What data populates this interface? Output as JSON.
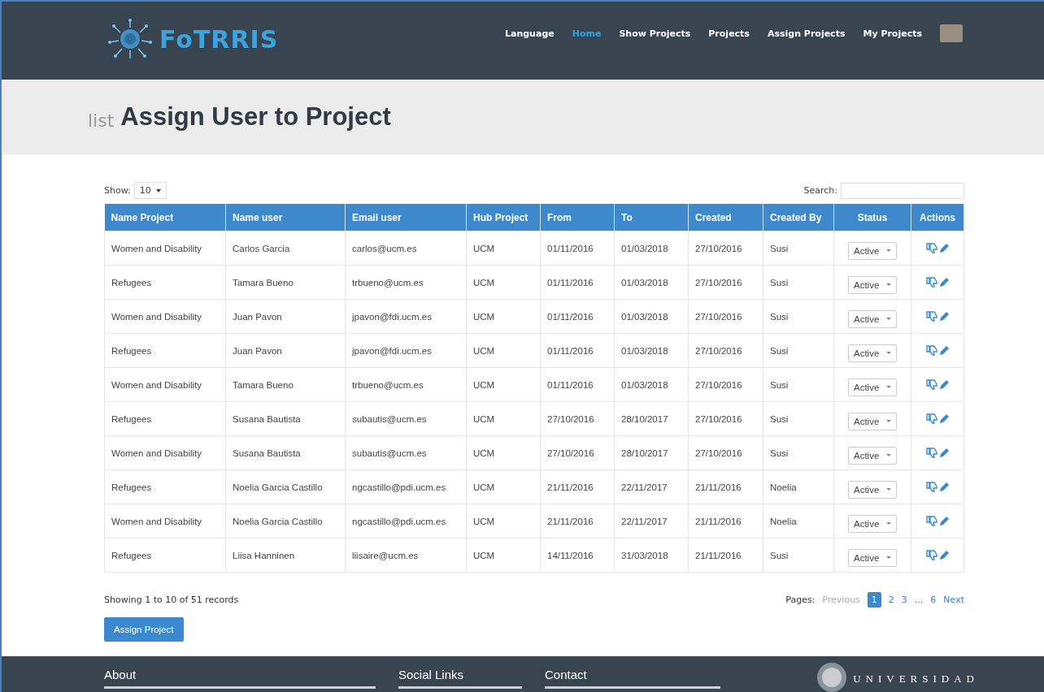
{
  "header": {
    "logo": "FoTRRIS",
    "nav": [
      {
        "label": "Language",
        "selected": false
      },
      {
        "label": "Home",
        "selected": true
      },
      {
        "label": "Show Projects",
        "selected": false
      },
      {
        "label": "Projects",
        "selected": false
      },
      {
        "label": "Assign Projects",
        "selected": false
      },
      {
        "label": "My Projects",
        "selected": false
      }
    ]
  },
  "page_title": {
    "prefix": "list",
    "title": "Assign User to Project"
  },
  "table_controls": {
    "show_label": "Show:",
    "show_value": "10",
    "search_label": "Search:"
  },
  "table": {
    "columns": [
      "Name Project",
      "Name user",
      "Email user",
      "Hub Project",
      "From",
      "To",
      "Created",
      "Created By",
      "Status",
      "Actions"
    ],
    "rows": [
      [
        "Women and Disability",
        "Carlos Garcia",
        "carlos@ucm.es",
        "UCM",
        "01/11/2016",
        "01/03/2018",
        "27/10/2016",
        "Susi",
        "Active"
      ],
      [
        "Refugees",
        "Tamara Bueno",
        "trbueno@ucm.es",
        "UCM",
        "01/11/2016",
        "01/03/2018",
        "27/10/2016",
        "Susi",
        "Active"
      ],
      [
        "Women and Disability",
        "Juan Pavon",
        "jpavon@fdi.ucm.es",
        "UCM",
        "01/11/2016",
        "01/03/2018",
        "27/10/2016",
        "Susi",
        "Active"
      ],
      [
        "Refugees",
        "Juan Pavon",
        "jpavon@fdi.ucm.es",
        "UCM",
        "01/11/2016",
        "01/03/2018",
        "27/10/2016",
        "Susi",
        "Active"
      ],
      [
        "Women and Disability",
        "Tamara Bueno",
        "trbueno@ucm.es",
        "UCM",
        "01/11/2016",
        "01/03/2018",
        "27/10/2016",
        "Susi",
        "Active"
      ],
      [
        "Refugees",
        "Susana Bautista",
        "subautis@ucm.es",
        "UCM",
        "27/10/2016",
        "28/10/2017",
        "27/10/2016",
        "Susi",
        "Active"
      ],
      [
        "Women and Disability",
        "Susana Bautista",
        "subautis@ucm.es",
        "UCM",
        "27/10/2016",
        "28/10/2017",
        "27/10/2016",
        "Susi",
        "Active"
      ],
      [
        "Refugees",
        "Noelia Garcia Castillo",
        "ngcastillo@pdi.ucm.es",
        "UCM",
        "21/11/2016",
        "22/11/2017",
        "21/11/2016",
        "Noelia",
        "Active"
      ],
      [
        "Women and Disability",
        "Noelia Garcia Castillo",
        "ngcastillo@pdi.ucm.es",
        "UCM",
        "21/11/2016",
        "22/11/2017",
        "21/11/2016",
        "Noelia",
        "Active"
      ],
      [
        "Refugees",
        "Liisa Hanninen",
        "liisaire@ucm.es",
        "UCM",
        "14/11/2016",
        "31/03/2018",
        "21/11/2016",
        "Susi",
        "Active"
      ]
    ]
  },
  "info": "Showing 1 to 10 of 51 records",
  "pagination": {
    "label": "Pages:",
    "items": [
      {
        "label": "Previous",
        "kind": "link",
        "disabled": true,
        "selected": false
      },
      {
        "label": "1",
        "kind": "page",
        "disabled": false,
        "selected": true
      },
      {
        "label": "2",
        "kind": "page",
        "disabled": false,
        "selected": false
      },
      {
        "label": "3",
        "kind": "page",
        "disabled": false,
        "selected": false
      },
      {
        "label": "...",
        "kind": "gap",
        "disabled": false,
        "selected": false
      },
      {
        "label": "6",
        "kind": "page",
        "disabled": false,
        "selected": false
      },
      {
        "label": "Next",
        "kind": "link",
        "disabled": false,
        "selected": false
      }
    ]
  },
  "assign_button": "Assign Project",
  "footer": {
    "columns": [
      "About",
      "Social Links",
      "Contact"
    ],
    "university": "UNIVERSIDAD"
  }
}
